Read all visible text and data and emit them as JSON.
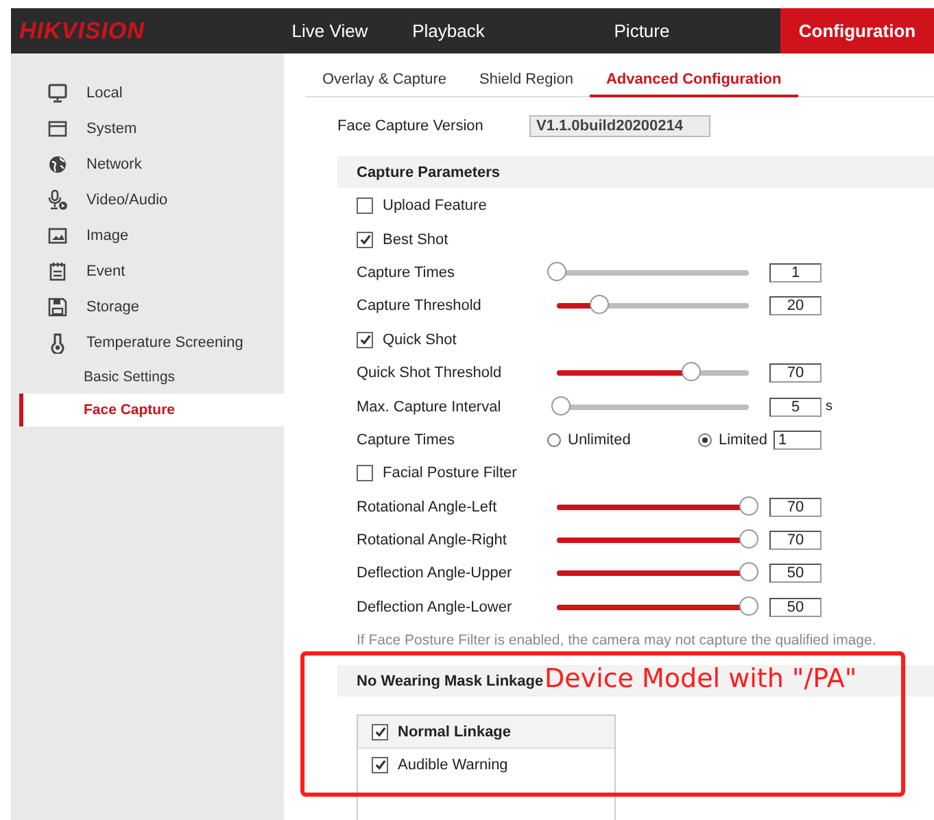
{
  "header": {
    "logo": "HIKVISION",
    "nav": [
      {
        "label": "Live View",
        "selected": false
      },
      {
        "label": "Playback",
        "selected": false
      },
      {
        "label": "Picture",
        "selected": false
      },
      {
        "label": "Configuration",
        "selected": true
      }
    ]
  },
  "sidebar": {
    "items": [
      {
        "label": "Local",
        "selected": false
      },
      {
        "label": "System",
        "selected": false
      },
      {
        "label": "Network",
        "selected": false
      },
      {
        "label": "Video/Audio",
        "selected": false
      },
      {
        "label": "Image",
        "selected": false
      },
      {
        "label": "Event",
        "selected": false
      },
      {
        "label": "Storage",
        "selected": false
      },
      {
        "label": "Temperature Screening",
        "selected": false,
        "children": [
          {
            "label": "Basic Settings",
            "selected": false
          },
          {
            "label": "Face Capture",
            "selected": true
          }
        ]
      }
    ]
  },
  "tabs": [
    {
      "label": "Overlay & Capture",
      "selected": false
    },
    {
      "label": "Shield Region",
      "selected": false
    },
    {
      "label": "Advanced Configuration",
      "selected": true
    }
  ],
  "version": {
    "label": "Face Capture Version",
    "value": "V1.1.0build20200214"
  },
  "capture_parameters": {
    "title": "Capture Parameters",
    "rows": [
      {
        "kind": "checkbox",
        "label": "Upload Feature",
        "checked": false
      },
      {
        "kind": "checkbox",
        "label": "Best Shot",
        "checked": true
      },
      {
        "kind": "slider",
        "label": "Capture Times",
        "level": 0,
        "value": "1"
      },
      {
        "kind": "slider",
        "label": "Capture Threshold",
        "level": 0.22,
        "value": "20"
      },
      {
        "kind": "checkbox",
        "label": "Quick Shot",
        "checked": true
      },
      {
        "kind": "slider",
        "label": "Quick Shot Threshold",
        "level": 0.7,
        "value": "70"
      },
      {
        "kind": "slider",
        "label": "Max. Capture Interval",
        "level": 0.02,
        "value": "5",
        "unit": "s"
      },
      {
        "kind": "radio",
        "label": "Capture Times",
        "options": [
          {
            "label": "Unlimited",
            "selected": false
          },
          {
            "label": "Limited",
            "selected": true,
            "value": "1"
          }
        ]
      },
      {
        "kind": "checkbox",
        "label": "Facial Posture Filter",
        "checked": false
      },
      {
        "kind": "slider",
        "label": "Rotational Angle-Left",
        "level": 1,
        "value": "70"
      },
      {
        "kind": "slider",
        "label": "Rotational Angle-Right",
        "level": 1,
        "value": "70"
      },
      {
        "kind": "slider",
        "label": "Deflection Angle-Upper",
        "level": 1,
        "value": "50"
      },
      {
        "kind": "slider",
        "label": "Deflection Angle-Lower",
        "level": 1,
        "value": "50"
      }
    ],
    "note": "If Face Posture Filter is enabled, the camera may not capture the qualified image."
  },
  "mask_linkage": {
    "title": "No Wearing Mask Linkage",
    "items": [
      {
        "label": "Normal Linkage",
        "checked": true,
        "kind": "header"
      },
      {
        "label": "Audible Warning",
        "checked": true,
        "kind": "item"
      }
    ]
  },
  "annotation": {
    "text": "Device Model with \"/PA\""
  }
}
